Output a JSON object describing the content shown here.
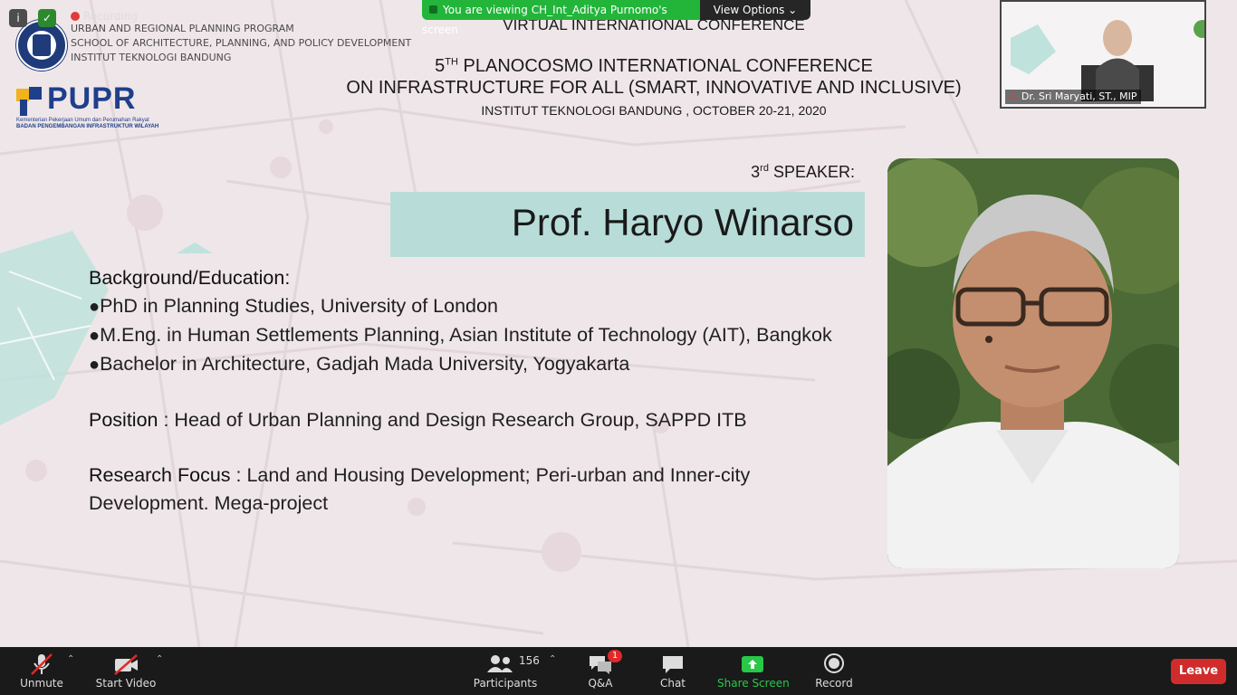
{
  "zoom": {
    "recording_label": "Recording",
    "viewing_banner": "You are viewing CH_Int_Aditya Purnomo's screen",
    "view_options_label": "View Options",
    "thumbnail_name": "Dr. Sri Maryati, ST., MIP"
  },
  "slide": {
    "program_lines": [
      "URBAN AND REGIONAL PLANNING  PROGRAM",
      "SCHOOL OF ARCHITECTURE, PLANNING, AND POLICY DEVELOPMENT",
      "INSTITUT TEKNOLOGI BANDUNG"
    ],
    "pupr_word": "PUPR",
    "pupr_sub1": "Kementerian Pekerjaan Umum dan Perumahan Rakyat",
    "pupr_sub2": "BADAN PENGEMBANGAN INFRASTRUKTUR WILAYAH",
    "seal_year": "1920",
    "conf_virtual": "VIRTUAL INTERNATIONAL CONFERENCE",
    "conf_title_num": "5",
    "conf_title_sup": "TH",
    "conf_title_rest": " PLANOCOSMO INTERNATIONAL CONFERENCE",
    "conf_subtitle": "ON INFRASTRUCTURE FOR ALL (SMART, INNOVATIVE AND INCLUSIVE)",
    "conf_place": "INSTITUT TEKNOLOGI BANDUNG , OCTOBER 20-21, 2020",
    "speaker_rank_num": "3",
    "speaker_rank_sup": "rd",
    "speaker_rank_rest": " SPEAKER:",
    "speaker_name": "Prof. Haryo Winarso",
    "bio": {
      "education_heading": "Background/Education:",
      "education": [
        "PhD in Planning Studies, University of London",
        "M.Eng. in Human Settlements Planning, Asian Institute of Technology (AIT), Bangkok",
        "Bachelor in Architecture, Gadjah Mada University, Yogyakarta"
      ],
      "position_label": "Position",
      "position_value": " : Head of Urban Planning and Design Research Group, SAPPD ITB",
      "research_label": "Research Focus",
      "research_value": " : Land and Housing Development;  Peri-urban and Inner-city Development. Mega-project"
    }
  },
  "toolbar": {
    "unmute": "Unmute",
    "start_video": "Start Video",
    "participants": "Participants",
    "participants_count": "156",
    "qa": "Q&A",
    "qa_badge": "1",
    "chat": "Chat",
    "share_screen": "Share Screen",
    "record": "Record",
    "leave": "Leave"
  },
  "colors": {
    "share_green": "#23b53a",
    "leave_red": "#d02c2c",
    "name_box": "#b8ddd9"
  }
}
